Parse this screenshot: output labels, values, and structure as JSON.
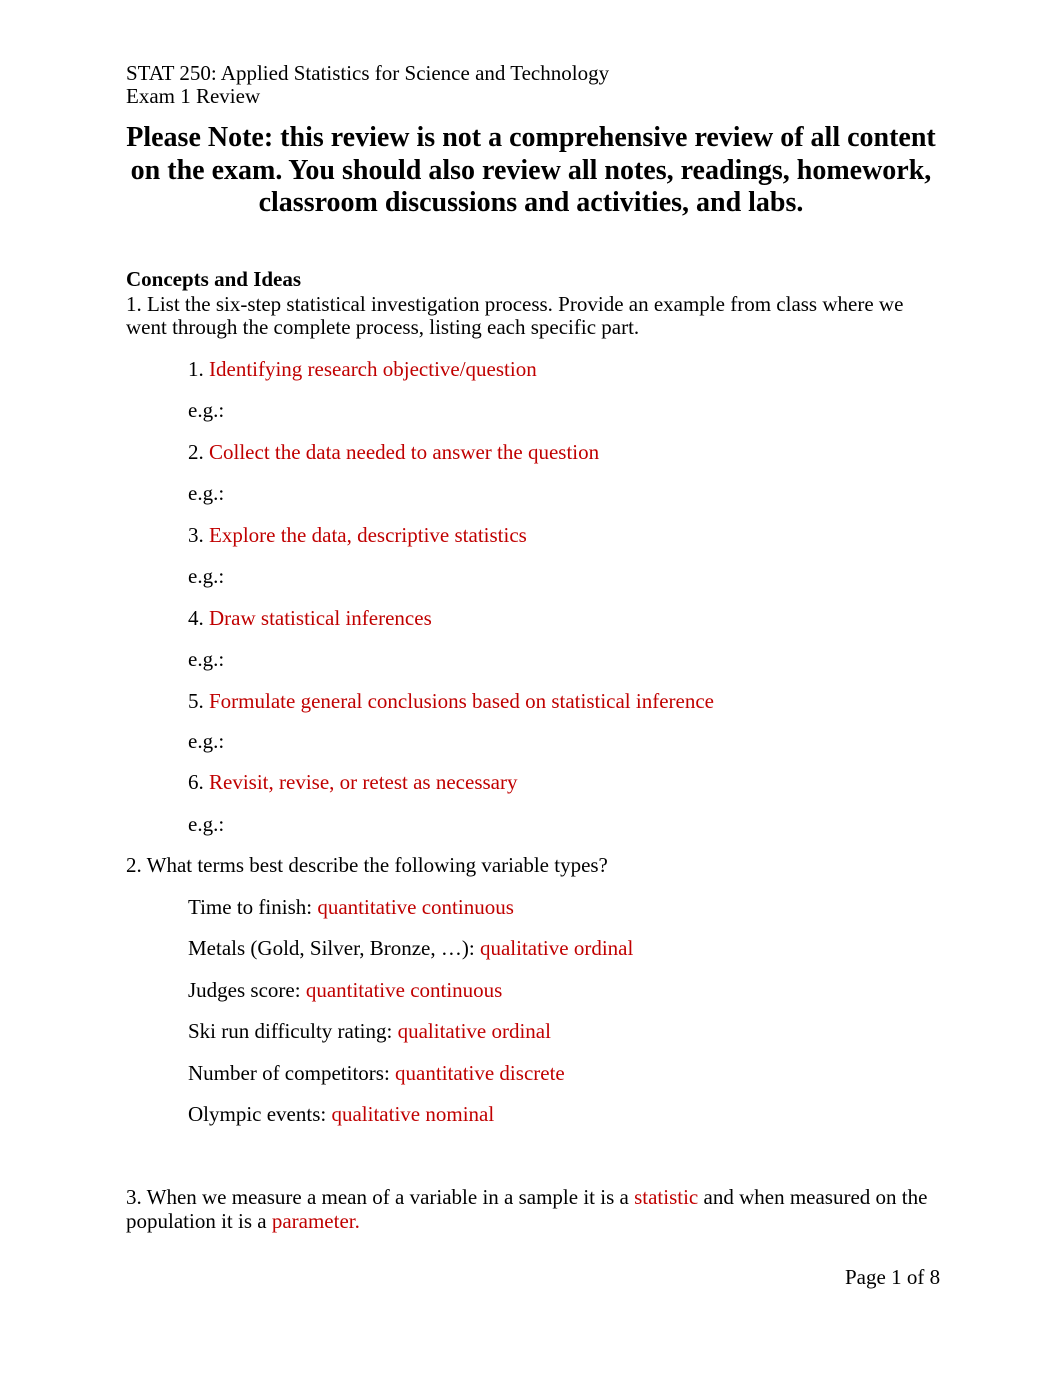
{
  "header": {
    "course": "STAT 250: Applied Statistics for Science and Technology",
    "subtitle": "Exam 1 Review"
  },
  "note": {
    "line1": "Please Note: this review is not a comprehensive review of all content",
    "line2": "on the exam.  You should also review all notes, readings, homework,",
    "line3": "classroom discussions and activities, and labs."
  },
  "section_heading": "Concepts and Ideas",
  "q1": {
    "line1": "1. List the six-step statistical investigation process. Provide an example from class where we",
    "line2": "went through the complete process, listing each specific part.",
    "steps": [
      {
        "num": "1. ",
        "answer": "Identifying research objective/question",
        "eg": "e.g.:"
      },
      {
        "num": "2. ",
        "answer": "Collect the data needed to answer the question",
        "eg": "e.g.:"
      },
      {
        "num": "3. ",
        "answer": "Explore the data, descriptive statistics",
        "eg": "e.g.:"
      },
      {
        "num": "4. ",
        "answer": "Draw statistical inferences",
        "eg": "e.g.:"
      },
      {
        "num": "5. ",
        "answer": "Formulate general conclusions based on statistical inference",
        "eg": "e.g.:"
      },
      {
        "num": "6. ",
        "answer": "Revisit, revise, or retest as necessary",
        "eg": "e.g.:"
      }
    ]
  },
  "q2": {
    "question": "2. What terms best describe the following variable types?",
    "items": [
      {
        "label": "Time to finish: ",
        "answer": "quantitative continuous"
      },
      {
        "label": "Metals (Gold, Silver, Bronze, …): ",
        "answer": "qualitative ordinal"
      },
      {
        "label": "Judges score: ",
        "answer": "quantitative continuous"
      },
      {
        "label": "Ski run difficulty rating: ",
        "answer": "qualitative ordinal"
      },
      {
        "label": "Number of competitors: ",
        "answer": "quantitative discrete"
      },
      {
        "label": "Olympic events: ",
        "answer": "qualitative nominal"
      }
    ]
  },
  "q3": {
    "part1": "3. When we measure a mean of a variable in a sample it is a ",
    "answer1": "statistic",
    "part2": " and when measured on the",
    "part3": "population it is a ",
    "answer2": "parameter."
  },
  "footer": {
    "page": "Page 1 of 8"
  },
  "colors": {
    "answer": "#c00000",
    "text": "#000000"
  }
}
